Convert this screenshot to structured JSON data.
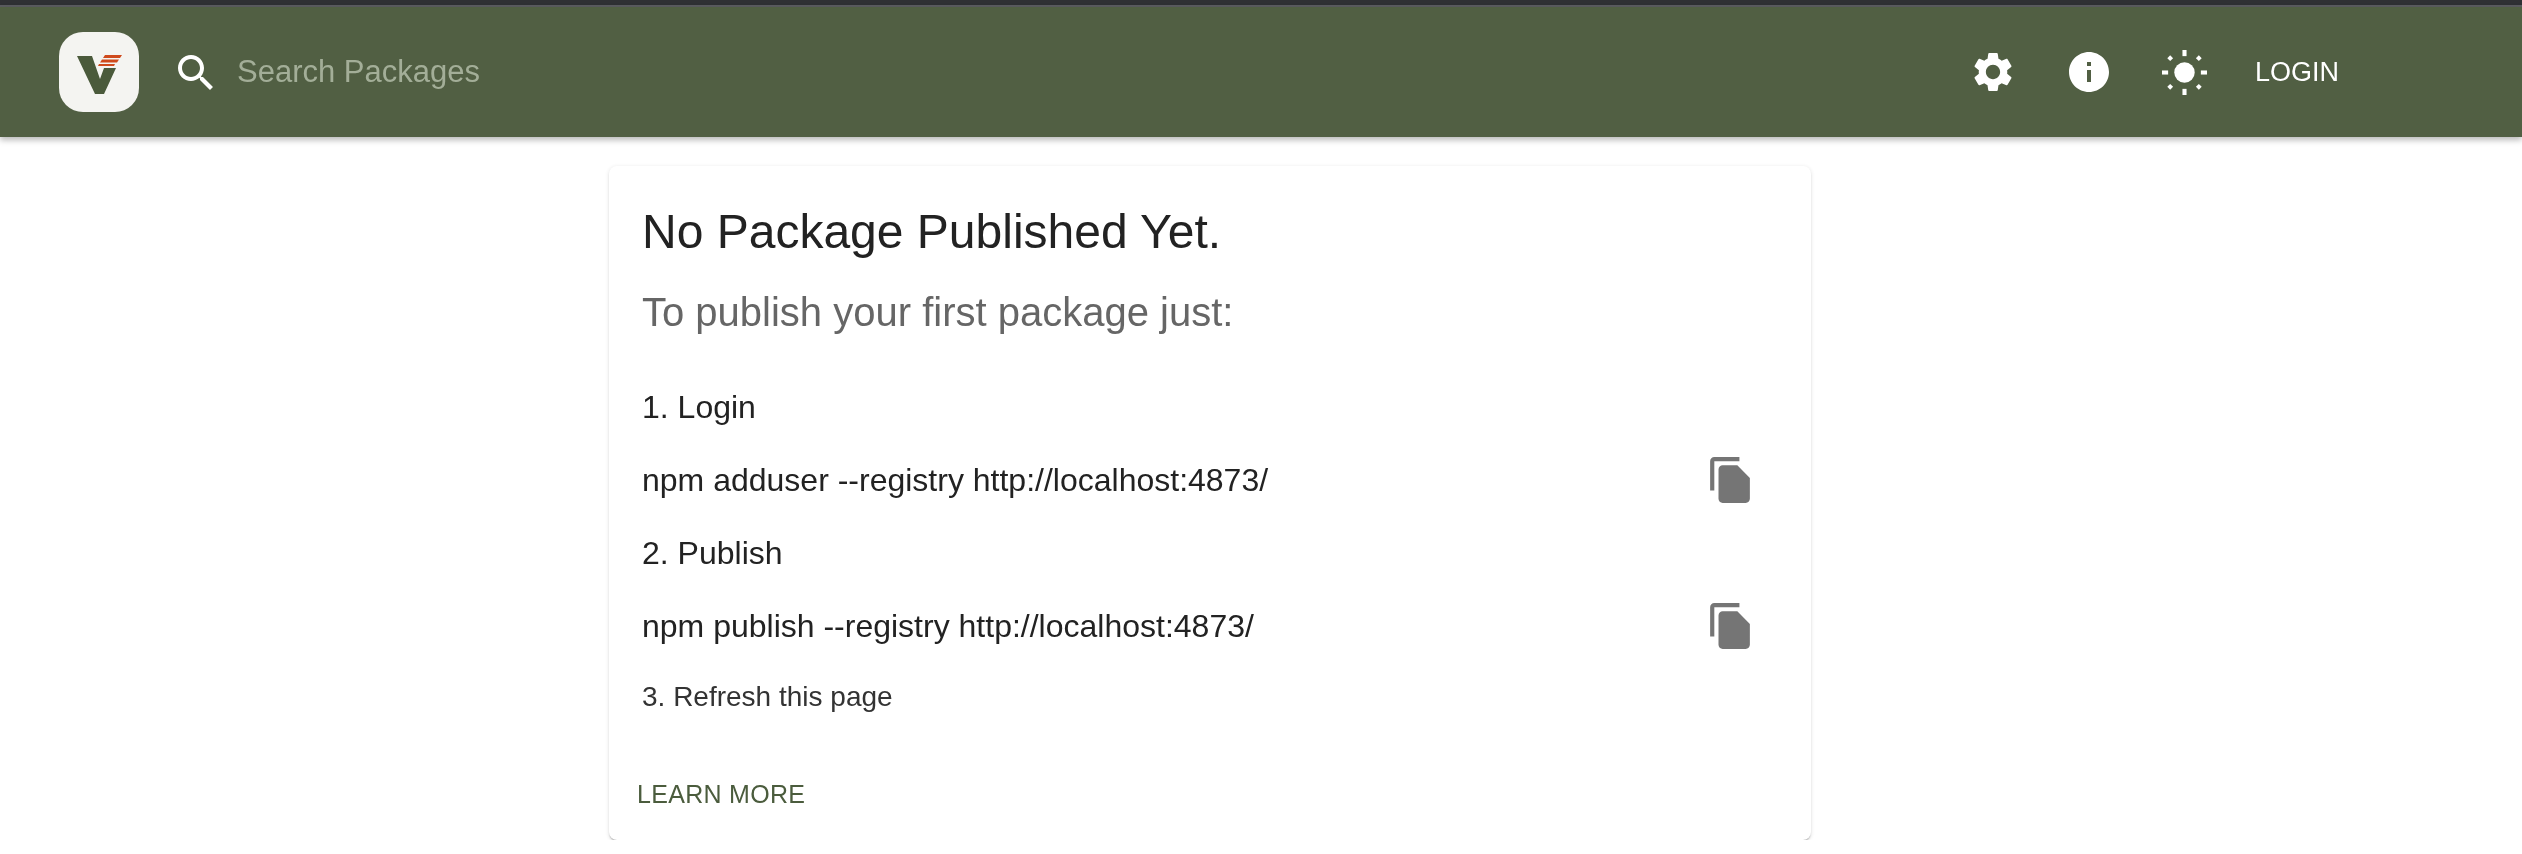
{
  "header": {
    "search": {
      "placeholder": "Search Packages"
    },
    "login_button": "LOGIN"
  },
  "card": {
    "title": "No Package Published Yet.",
    "subtitle": "To publish your first package just:",
    "steps": [
      {
        "kind": "heading",
        "text": "1. Login"
      },
      {
        "kind": "command",
        "text": "npm adduser --registry http://localhost:4873/"
      },
      {
        "kind": "heading",
        "text": "2. Publish"
      },
      {
        "kind": "command",
        "text": "npm publish --registry http://localhost:4873/"
      },
      {
        "kind": "note",
        "text": "3. Refresh this page"
      }
    ],
    "link": "LEARN MORE"
  }
}
